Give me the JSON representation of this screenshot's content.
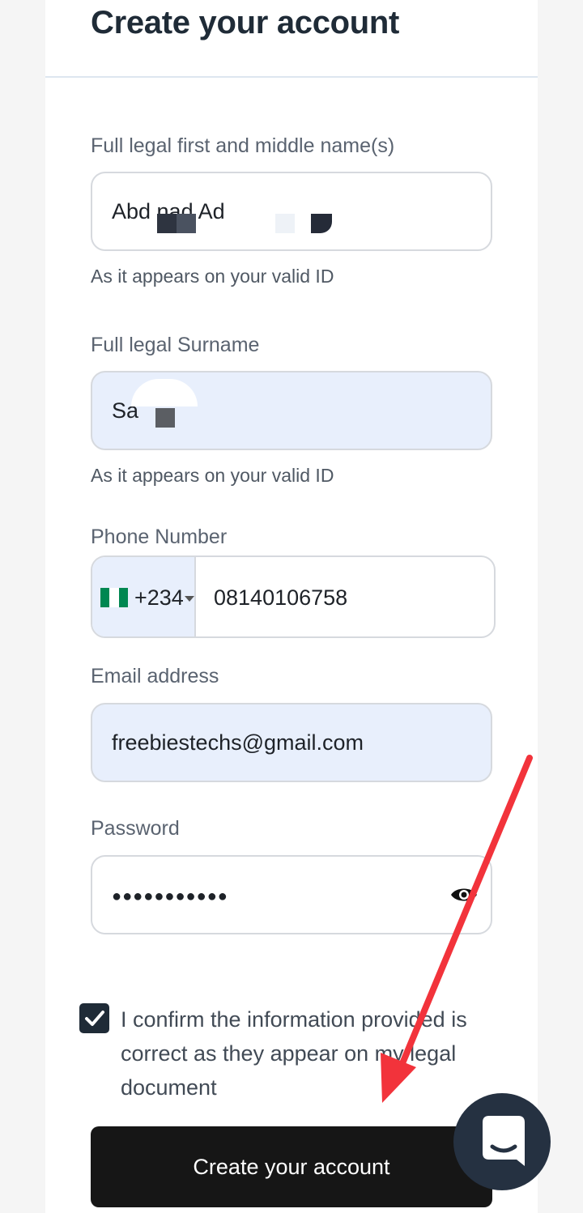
{
  "header": {
    "title": "Create your account"
  },
  "form": {
    "first_name": {
      "label": "Full legal first and middle name(s)",
      "value": "Abd     nad Ad",
      "hint": "As it appears on your valid ID"
    },
    "surname": {
      "label": "Full legal Surname",
      "value": "Sa",
      "hint": "As it appears on your valid ID"
    },
    "phone": {
      "label": "Phone Number",
      "country_code": "+234",
      "country_flag": "nigeria-flag-icon",
      "value": "08140106758"
    },
    "email": {
      "label": "Email address",
      "value": "freebiestechs@gmail.com"
    },
    "password": {
      "label": "Password",
      "value": "●●●●●●●●●●●",
      "toggle_icon": "eye-icon"
    },
    "confirm": {
      "checked": true,
      "text": "I confirm the information provided is correct as they appear on my legal document"
    },
    "submit_label": "Create your account"
  },
  "chat_widget": {
    "icon": "chat-bubble-icon"
  },
  "colors": {
    "accent_dark": "#1f2b37",
    "button": "#161616",
    "autofill_bg": "#e8effc",
    "annotation_arrow": "#f2333b",
    "flag_green": "#008751"
  }
}
